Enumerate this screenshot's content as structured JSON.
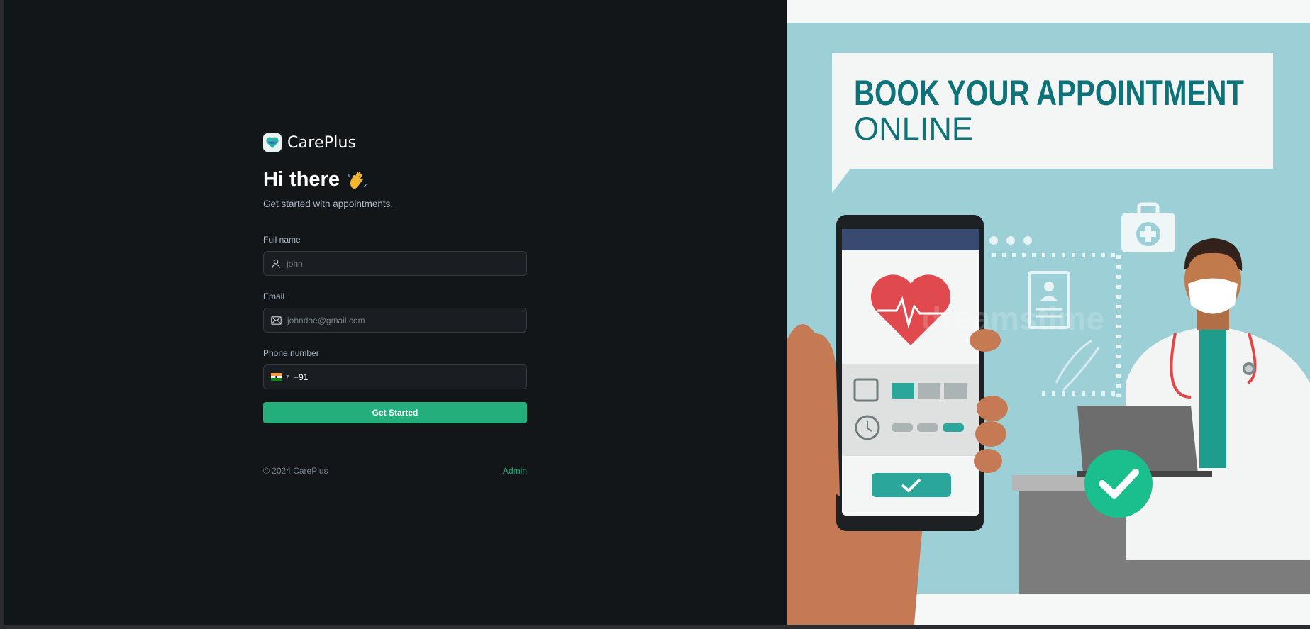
{
  "brand": {
    "name": "CarePlus"
  },
  "hero": {
    "title": "Hi there",
    "subtitle": "Get started with appointments."
  },
  "form": {
    "full_name": {
      "label": "Full name",
      "placeholder": "john"
    },
    "email": {
      "label": "Email",
      "placeholder": "johndoe@gmail.com"
    },
    "phone": {
      "label": "Phone number",
      "country_code": "+91"
    },
    "submit_label": "Get Started"
  },
  "footer": {
    "copyright": "© 2024 CarePlus",
    "admin_link": "Admin"
  },
  "illustration": {
    "headline_line1": "BOOK YOUR APPOINTMENT",
    "headline_line2": "ONLINE",
    "watermark": "dreamstime"
  },
  "colors": {
    "accent": "#24ae7c",
    "background": "#131619",
    "field_bg": "#1a1d21",
    "teal": "#0e7279",
    "sky": "#9ccfd6"
  },
  "icons": [
    "careplus-logo-icon",
    "wave-hand-icon",
    "user-icon",
    "mail-icon",
    "india-flag-icon",
    "chevron-down-icon"
  ]
}
